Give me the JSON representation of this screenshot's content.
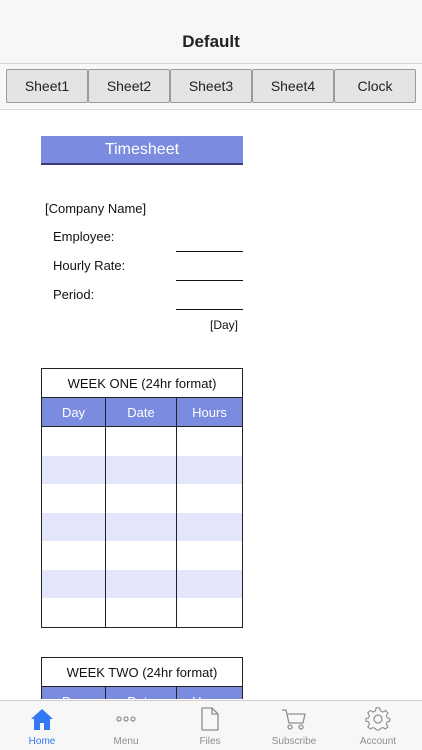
{
  "navbar": {
    "title": "Default"
  },
  "tabs": [
    "Sheet1",
    "Sheet2",
    "Sheet3",
    "Sheet4",
    "Clock"
  ],
  "timesheet": {
    "title": "Timesheet",
    "company": "[Company Name]",
    "fields": [
      "Employee:",
      "Hourly Rate:",
      "Period:"
    ],
    "day_note": "[Day]"
  },
  "weeks": [
    {
      "title": "WEEK ONE (24hr format)",
      "columns": [
        "Day",
        "Date",
        "Hours"
      ]
    },
    {
      "title": "WEEK TWO (24hr format)",
      "columns": [
        "Day",
        "Date",
        "Hours"
      ]
    }
  ],
  "tabbar": {
    "items": [
      {
        "label": "Home",
        "icon": "home-icon"
      },
      {
        "label": "Menu",
        "icon": "more-icon"
      },
      {
        "label": "Files",
        "icon": "file-icon"
      },
      {
        "label": "Subscribe",
        "icon": "cart-icon"
      },
      {
        "label": "Account",
        "icon": "gear-icon"
      }
    ],
    "active_index": 0
  },
  "colors": {
    "header_blue": "#7b8be0",
    "row_alt": "#e3e6fa",
    "accent": "#3478f6"
  }
}
